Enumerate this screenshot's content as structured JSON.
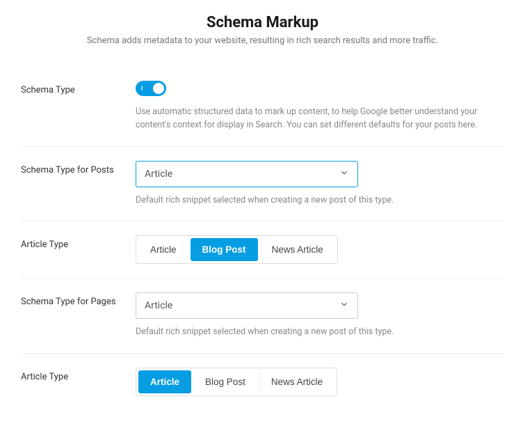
{
  "header": {
    "title": "Schema Markup",
    "subtitle": "Schema adds metadata to your website, resulting in rich search results and more traffic."
  },
  "schema_type": {
    "label": "Schema Type",
    "toggle_on": true,
    "toggle_indicator": "I",
    "desc": "Use automatic structured data to mark up content, to help Google better understand your content's context for display in Search. You can set different defaults for your posts here."
  },
  "posts": {
    "label": "Schema Type for Posts",
    "value": "Article",
    "desc": "Default rich snippet selected when creating a new post of this type."
  },
  "article_type_posts": {
    "label": "Article Type",
    "options": [
      "Article",
      "Blog Post",
      "News Article"
    ],
    "selected": "Blog Post"
  },
  "pages": {
    "label": "Schema Type for Pages",
    "value": "Article",
    "desc": "Default rich snippet selected when creating a new post of this type."
  },
  "article_type_pages": {
    "label": "Article Type",
    "options": [
      "Article",
      "Blog Post",
      "News Article"
    ],
    "selected": "Article"
  }
}
